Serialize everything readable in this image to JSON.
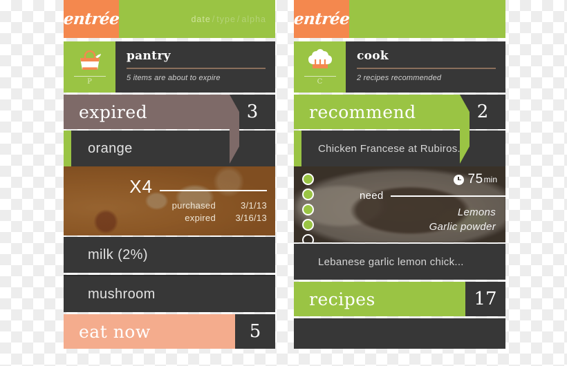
{
  "app": {
    "name": "entrée",
    "brand_orange": "#f4884e",
    "brand_green": "#9ac444",
    "dark": "#373737",
    "mauve": "#7e6a68",
    "salmon": "#f4ac8d"
  },
  "screens": [
    {
      "id": "pantry",
      "header": {
        "logo": "entrée",
        "sort": {
          "options": [
            "date",
            "type",
            "alpha"
          ],
          "selected": "date",
          "separator": "/"
        }
      },
      "section": {
        "icon_name": "basket-icon",
        "icon_key": "P",
        "title": "pantry",
        "subtitle": "5 items are about to expire"
      },
      "banner": {
        "label": "expired",
        "count": "3",
        "color": "#7e6a68"
      },
      "items": [
        {
          "name": "orange",
          "accent": true,
          "expanded": true,
          "detail": {
            "quantity": "X4",
            "rows": [
              {
                "key": "purchased",
                "value": "3/1/13"
              },
              {
                "key": "expired",
                "value": "3/16/13"
              }
            ]
          }
        },
        {
          "name": "milk (2%)",
          "accent": false,
          "expanded": false
        },
        {
          "name": "mushroom",
          "accent": false,
          "expanded": false
        }
      ],
      "footer_banner": {
        "label": "eat now",
        "count": "5",
        "color": "#f4ac8d"
      }
    },
    {
      "id": "cook",
      "header": {
        "logo": "entrée",
        "sort": {
          "options": [],
          "selected": "",
          "separator": ""
        }
      },
      "section": {
        "icon_name": "chef-hat-icon",
        "icon_key": "C",
        "title": "cook",
        "subtitle": "2 recipes recommended"
      },
      "banner": {
        "label": "recommend",
        "count": "2",
        "color": "#9ac444"
      },
      "items": [
        {
          "name": "Chicken Francese at Rubiros...",
          "accent": true,
          "expanded": true,
          "detail": {
            "rating_filled": 4,
            "rating_total": 5,
            "time_value": "75",
            "time_unit": "min",
            "need_label": "need",
            "need_items": [
              "Lemons",
              "Garlic powder"
            ]
          }
        },
        {
          "name": "Lebanese garlic lemon chick...",
          "accent": false,
          "expanded": false
        }
      ],
      "footer_banner": {
        "label": "recipes",
        "count": "17",
        "color": "#9ac444"
      }
    }
  ]
}
